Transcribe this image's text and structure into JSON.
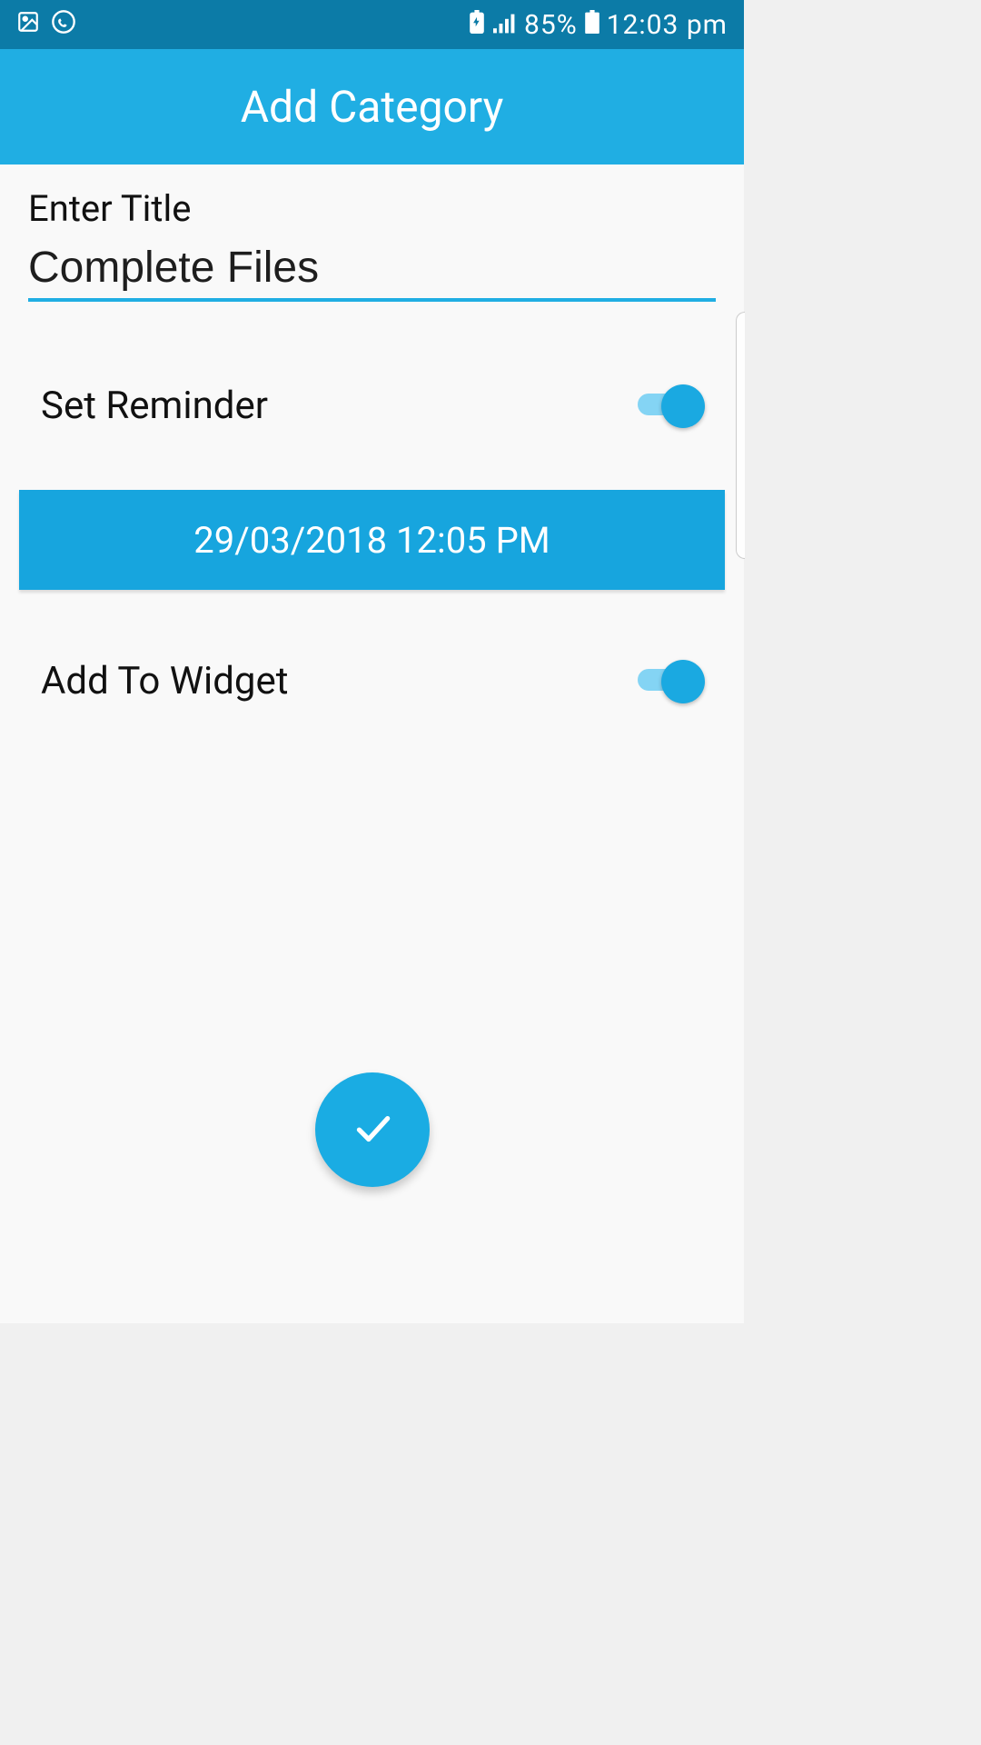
{
  "status_bar": {
    "battery_percent": "85%",
    "clock": "12:03 pm"
  },
  "app_bar": {
    "title": "Add Category"
  },
  "form": {
    "title_label": "Enter Title",
    "title_value": "Complete Files",
    "set_reminder_label": "Set Reminder",
    "set_reminder_on": true,
    "datetime": "29/03/2018 12:05 PM",
    "add_to_widget_label": "Add To Widget",
    "add_to_widget_on": true
  }
}
